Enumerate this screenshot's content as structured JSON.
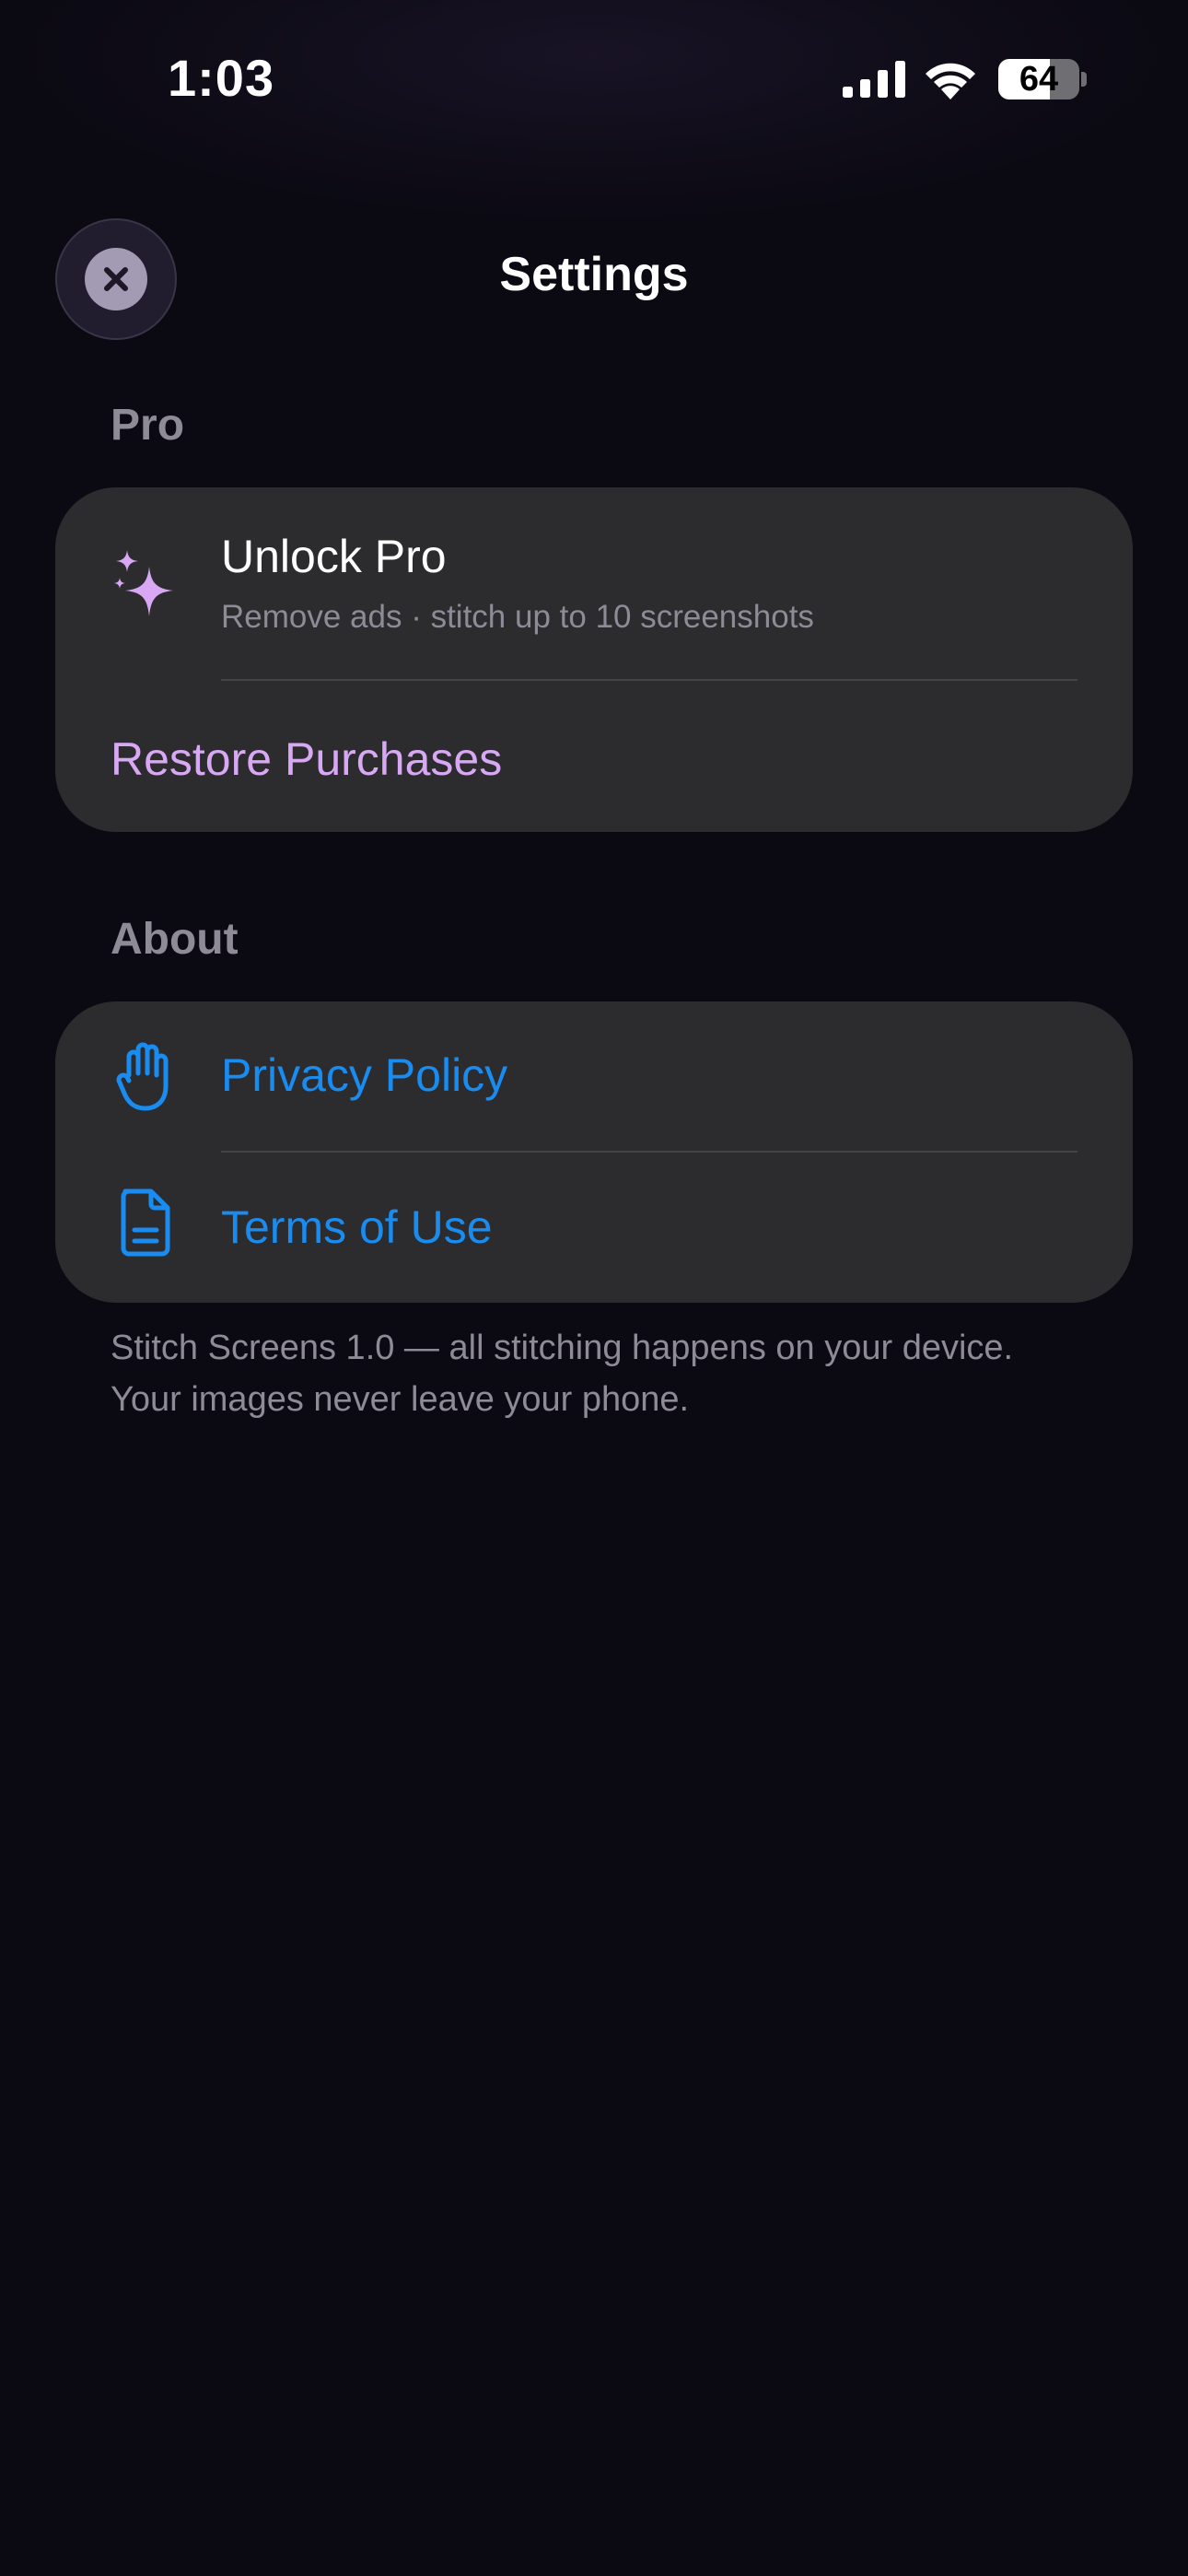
{
  "status_bar": {
    "time": "1:03",
    "battery_level": "64",
    "battery_fraction": 0.64
  },
  "header": {
    "title": "Settings",
    "close_icon": "xmark-icon"
  },
  "sections": {
    "pro": {
      "label": "Pro",
      "unlock_title": "Unlock Pro",
      "unlock_subtitle": "Remove ads · stitch up to 10 screenshots",
      "unlock_icon": "sparkles-icon",
      "restore_label": "Restore Purchases"
    },
    "about": {
      "label": "About",
      "privacy_label": "Privacy Policy",
      "privacy_icon": "hand-raised-icon",
      "terms_label": "Terms of Use",
      "terms_icon": "document-icon"
    }
  },
  "footer": {
    "note": "Stitch Screens 1.0 — all stitching happens on your device. Your images never leave your phone."
  },
  "colors": {
    "background": "#0b0912",
    "card": "#2c2c2e",
    "accent_purple": "#d9a8f5",
    "link_blue": "#1a8cf0",
    "secondary_text": "#8e8a96"
  }
}
